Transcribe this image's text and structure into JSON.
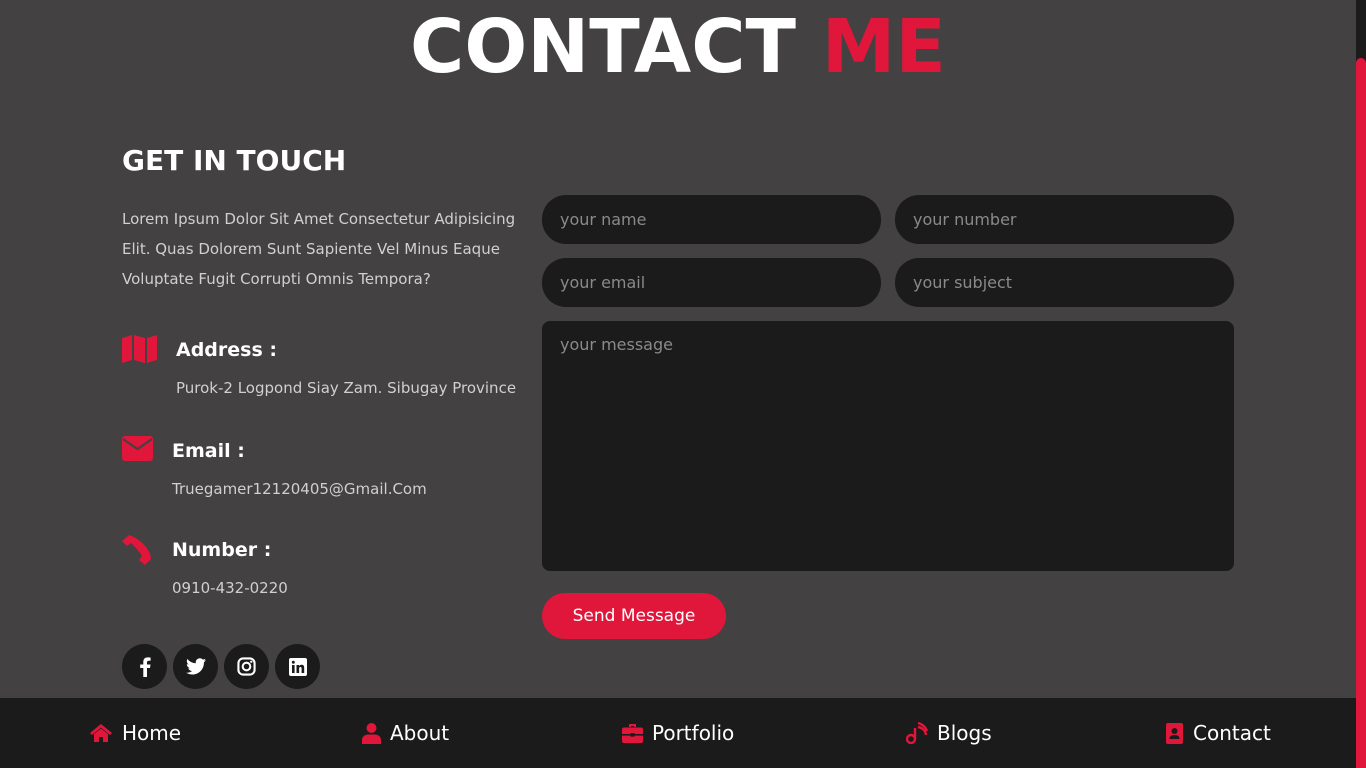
{
  "heading": {
    "main": "CONTACT",
    "accent": "ME"
  },
  "contact_info": {
    "title": "GET IN TOUCH",
    "intro": "Lorem Ipsum Dolor Sit Amet Consectetur Adipisicing Elit. Quas Dolorem Sunt Sapiente Vel Minus Eaque Voluptate Fugit Corrupti Omnis Tempora?",
    "address": {
      "label": "Address :",
      "value": "Purok-2 Logpond Siay Zam. Sibugay Province",
      "icon": "map-icon"
    },
    "email": {
      "label": "Email :",
      "value": "Truegamer12120405@Gmail.Com",
      "icon": "envelope-icon"
    },
    "number": {
      "label": "Number :",
      "value": "0910-432-0220",
      "icon": "phone-icon"
    }
  },
  "socials": [
    "facebook-icon",
    "twitter-icon",
    "instagram-icon",
    "linkedin-icon"
  ],
  "form": {
    "name_placeholder": "your name",
    "number_placeholder": "your number",
    "email_placeholder": "your email",
    "subject_placeholder": "your subject",
    "message_placeholder": "your message",
    "send_label": "Send Message"
  },
  "nav": {
    "home": "Home",
    "about": "About",
    "portfolio": "Portfolio",
    "blogs": "Blogs",
    "contact": "Contact"
  },
  "colors": {
    "accent": "#e0163b",
    "background": "#434142",
    "panel": "#1b1b1b"
  }
}
